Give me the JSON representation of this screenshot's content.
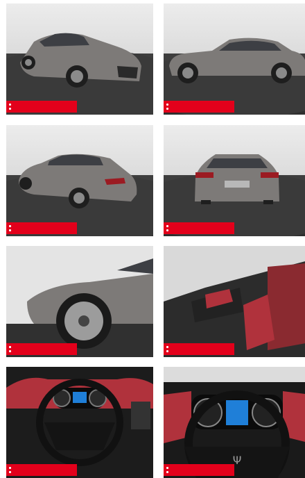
{
  "gallery": {
    "images": [
      {
        "name": "front-three-quarter-view",
        "badge": ""
      },
      {
        "name": "side-profile-view",
        "badge": ""
      },
      {
        "name": "rear-three-quarter-view",
        "badge": ""
      },
      {
        "name": "rear-view",
        "badge": ""
      },
      {
        "name": "front-wheel-detail",
        "badge": ""
      },
      {
        "name": "front-seats-interior",
        "badge": ""
      },
      {
        "name": "dashboard-steering-wheel",
        "badge": ""
      },
      {
        "name": "instrument-cluster-close-up",
        "badge": ""
      }
    ]
  },
  "colors": {
    "badge": "#e3001b",
    "car_body": "#7b7876",
    "turntable": "#363636",
    "studio_backdrop": "#e6e6e6",
    "interior_leather": "#b0323c"
  }
}
